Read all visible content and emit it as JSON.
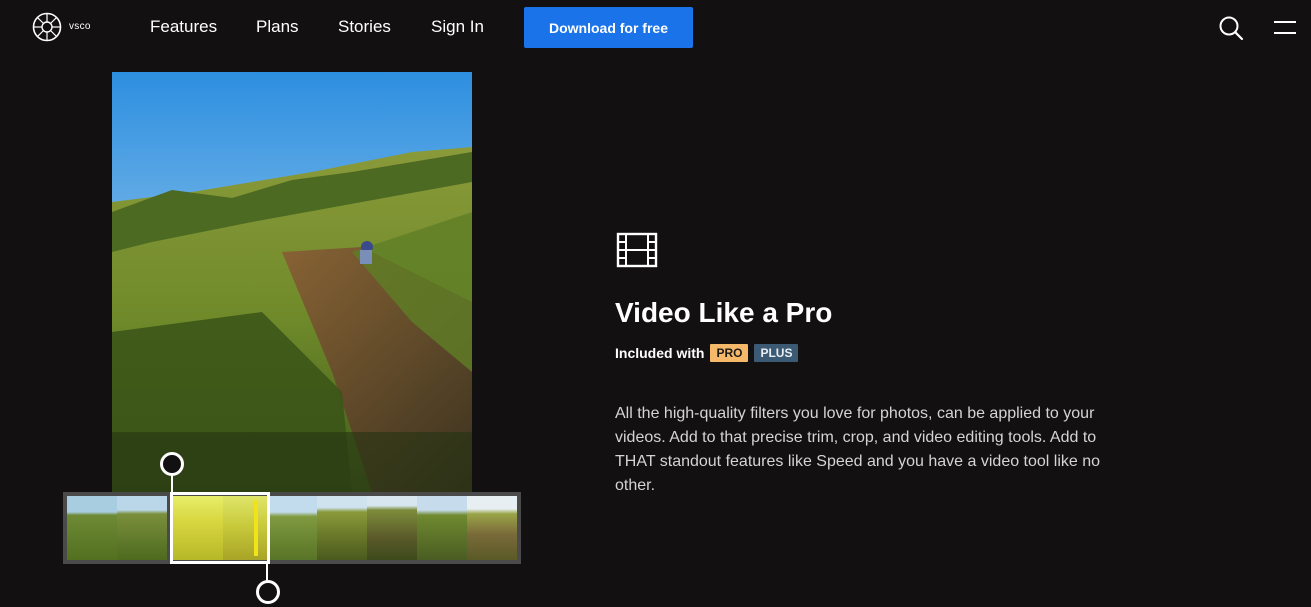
{
  "header": {
    "logo_text": "vsco",
    "nav": [
      "Features",
      "Plans",
      "Stories",
      "Sign In"
    ],
    "cta_label": "Download for free"
  },
  "feature": {
    "title": "Video Like a Pro",
    "included_label": "Included with",
    "badges": [
      "PRO",
      "PLUS"
    ],
    "description": "All the high-quality filters you love for photos, can be applied to your videos. Add to that precise trim, crop, and video editing tools. Add to THAT standout features like Speed and you have a video tool like no other."
  },
  "colors": {
    "background": "#121011",
    "cta": "#1a73e8",
    "badge_pro": "#f6b969",
    "badge_plus": "#3c5a73"
  },
  "icons": [
    "vsco-logo-icon",
    "search-icon",
    "menu-icon",
    "film-icon"
  ]
}
